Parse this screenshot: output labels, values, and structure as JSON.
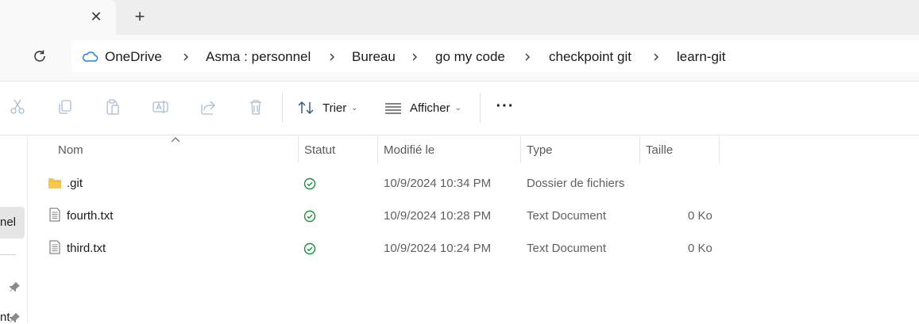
{
  "tabbar": {
    "close_glyph": "✕",
    "new_tab_glyph": "+"
  },
  "address": {
    "crumbs": [
      "OneDrive",
      "Asma : personnel",
      "Bureau",
      "go my code",
      "checkpoint git",
      "learn-git"
    ]
  },
  "toolbar": {
    "sort_label": "Trier",
    "view_label": "Afficher",
    "chevron": "⌄",
    "more": "···"
  },
  "sidebar": {
    "selected_fragment": "nel",
    "bottom_fragment": "nt"
  },
  "columns": {
    "name": "Nom",
    "status": "Statut",
    "modified": "Modifié le",
    "type": "Type",
    "size": "Taille"
  },
  "files": [
    {
      "name": ".git",
      "modified": "10/9/2024 10:34 PM",
      "type": "Dossier de fichiers",
      "size": "",
      "kind": "folder-icon"
    },
    {
      "name": "fourth.txt",
      "modified": "10/9/2024 10:28 PM",
      "type": "Text Document",
      "size": "0 Ko",
      "kind": "text-file-icon"
    },
    {
      "name": "third.txt",
      "modified": "10/9/2024 10:24 PM",
      "type": "Text Document",
      "size": "0 Ko",
      "kind": "text-file-icon"
    }
  ],
  "colors": {
    "onedrive": "#2a7fd4",
    "status_ok": "#1a8f3c",
    "folder": "#f6c94b"
  }
}
